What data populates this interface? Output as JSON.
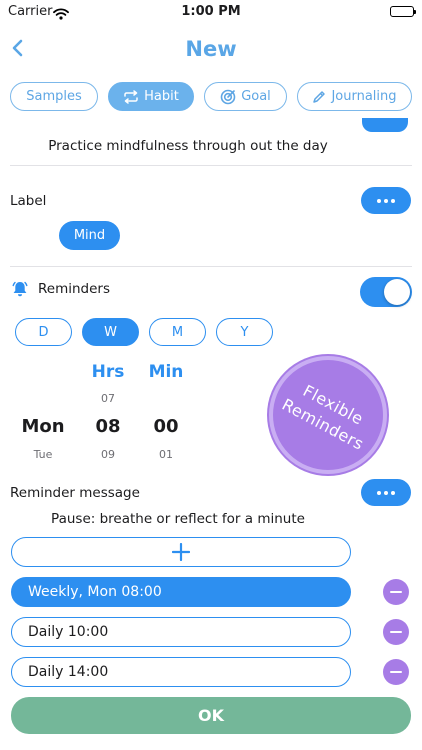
{
  "status_bar": {
    "carrier": "Carrier",
    "time": "1:00 PM",
    "battery_level": 1.0
  },
  "nav": {
    "title": "New",
    "back_icon": "chevron-left-icon"
  },
  "tabs": [
    {
      "label": "Samples",
      "icon": "",
      "active": false
    },
    {
      "label": "Habit",
      "icon": "repeat-icon",
      "active": true
    },
    {
      "label": "Goal",
      "icon": "target-icon",
      "active": false
    },
    {
      "label": "Journaling",
      "icon": "pen-icon",
      "active": false
    }
  ],
  "description": "Practice mindfulness through out the day",
  "label_section": {
    "title": "Label",
    "chip": "Mind"
  },
  "reminders": {
    "title": "Reminders",
    "enabled": true,
    "periods": [
      {
        "label": "D",
        "active": false
      },
      {
        "label": "W",
        "active": true
      },
      {
        "label": "M",
        "active": false
      },
      {
        "label": "Y",
        "active": false
      }
    ],
    "picker": {
      "day": {
        "current": "Mon",
        "next": "Tue"
      },
      "hours": {
        "header": "Hrs",
        "prev": "07",
        "current": "08",
        "next": "09"
      },
      "minutes": {
        "header": "Min",
        "prev": "",
        "current": "00",
        "next": "01"
      }
    },
    "badge_line1": "Flexible",
    "badge_line2": "Reminders",
    "message_title": "Reminder message",
    "message": "Pause: breathe or reflect for a minute",
    "items": [
      {
        "label": "Weekly, Mon 08:00",
        "active": true
      },
      {
        "label": "Daily 10:00",
        "active": false
      },
      {
        "label": "Daily 14:00",
        "active": false
      }
    ]
  },
  "ok_label": "OK",
  "colors": {
    "accent": "#2d8ff0",
    "title_blue": "#5aa6e6",
    "purple": "#a77ce6",
    "ok_green": "#74b799"
  }
}
